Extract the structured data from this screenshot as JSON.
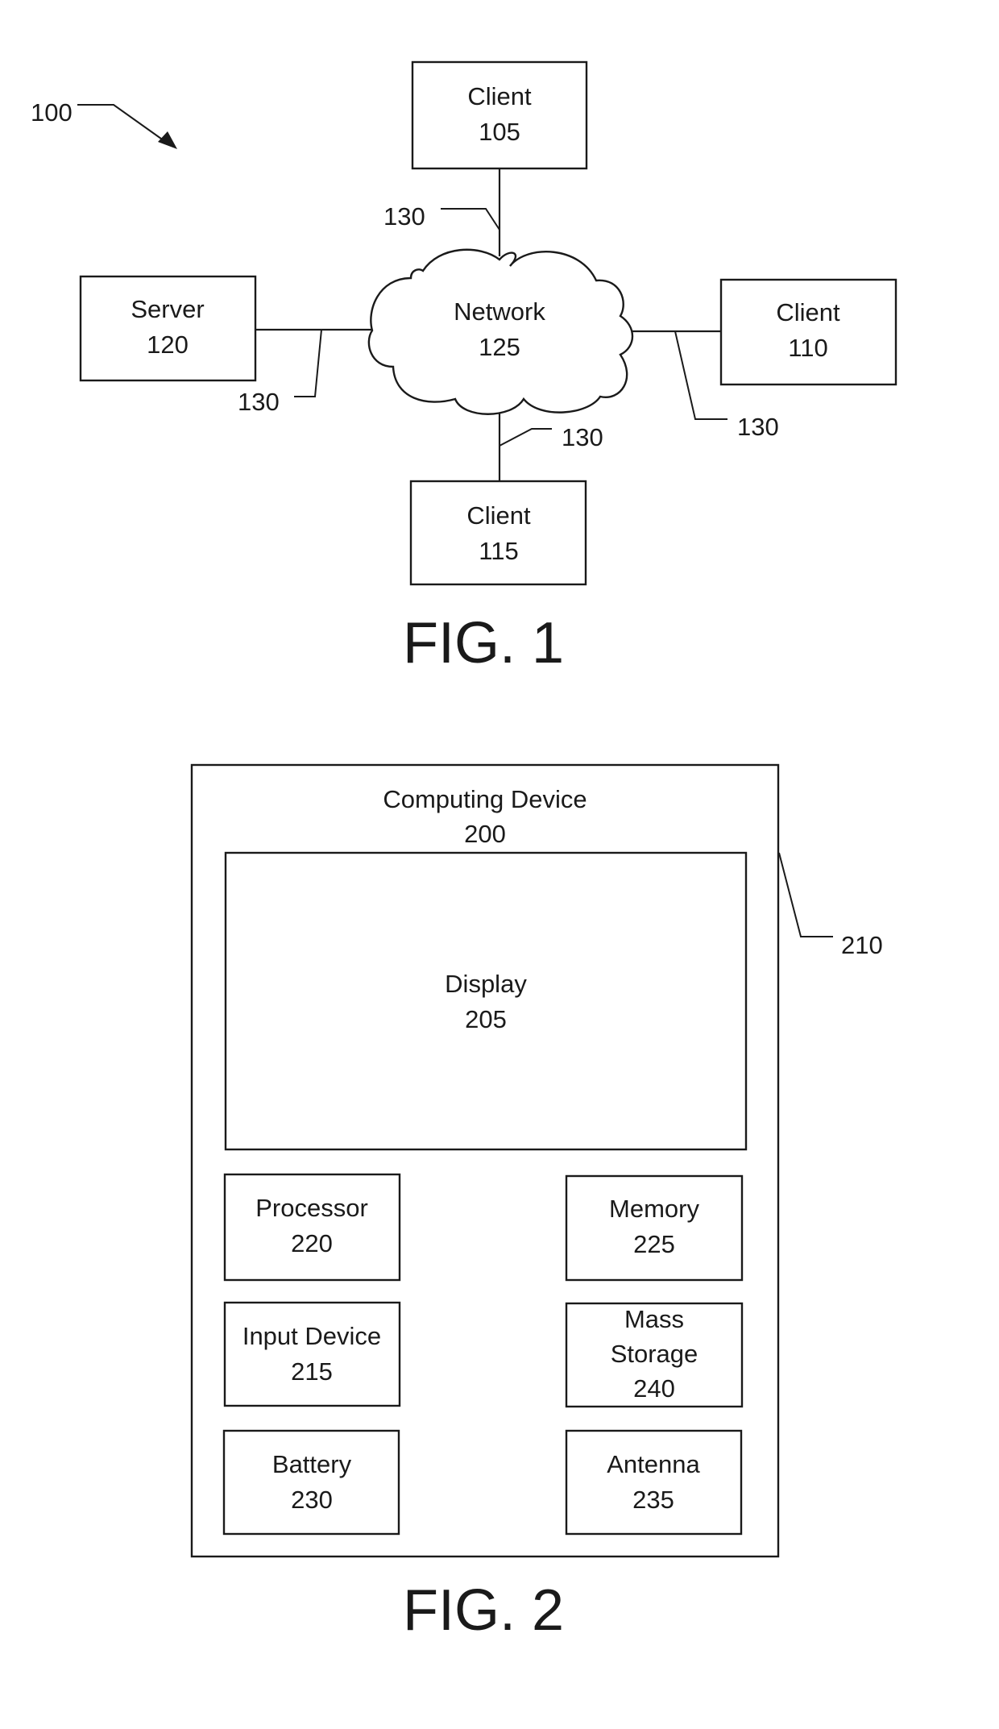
{
  "fig1": {
    "caption": "FIG. 1",
    "system_ref": "100",
    "link_ref": "130",
    "nodes": {
      "client_105": {
        "label": "Client",
        "ref": "105"
      },
      "client_110": {
        "label": "Client",
        "ref": "110"
      },
      "client_115": {
        "label": "Client",
        "ref": "115"
      },
      "server_120": {
        "label": "Server",
        "ref": "120"
      },
      "network_125": {
        "label": "Network",
        "ref": "125"
      }
    },
    "links": [
      {
        "from": "client_105",
        "to": "network_125",
        "ref": "130"
      },
      {
        "from": "server_120",
        "to": "network_125",
        "ref": "130"
      },
      {
        "from": "client_110",
        "to": "network_125",
        "ref": "130"
      },
      {
        "from": "client_115",
        "to": "network_125",
        "ref": "130"
      }
    ]
  },
  "fig2": {
    "caption": "FIG. 2",
    "device": {
      "label": "Computing Device",
      "ref": "200",
      "housing_ref": "210"
    },
    "display": {
      "label": "Display",
      "ref": "205"
    },
    "components": {
      "processor": {
        "label": "Processor",
        "ref": "220"
      },
      "memory": {
        "label": "Memory",
        "ref": "225"
      },
      "input_device": {
        "label": "Input Device",
        "ref": "215"
      },
      "mass_storage": {
        "line1": "Mass",
        "line2": "Storage",
        "ref": "240"
      },
      "battery": {
        "label": "Battery",
        "ref": "230"
      },
      "antenna": {
        "label": "Antenna",
        "ref": "235"
      }
    }
  }
}
